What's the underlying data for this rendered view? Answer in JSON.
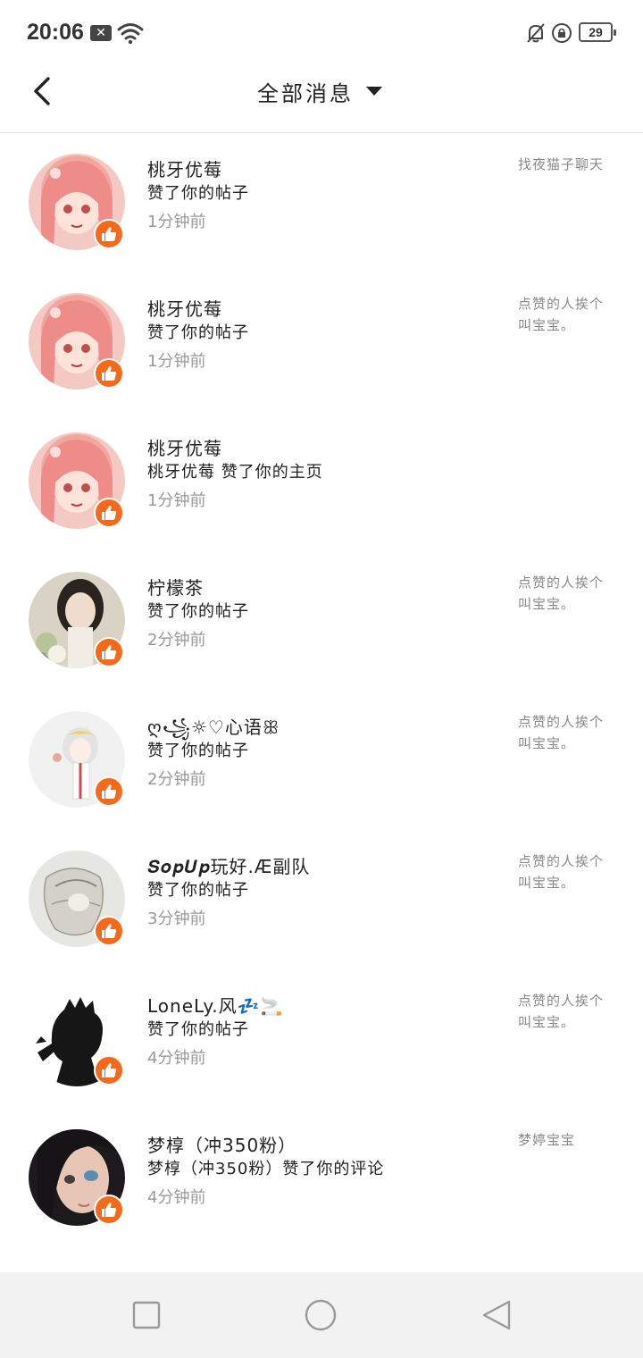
{
  "status_bar": {
    "time": "20:06",
    "notification_x": "✕",
    "battery": "29"
  },
  "header": {
    "title": "全部消息"
  },
  "messages": [
    {
      "name": "桃牙优莓",
      "action": "赞了你的帖子",
      "time": "1分钟前",
      "preview": "找夜猫子聊天",
      "avatar": "pink-anime-girl"
    },
    {
      "name": "桃牙优莓",
      "action": "赞了你的帖子",
      "time": "1分钟前",
      "preview": "点赞的人挨个叫宝宝。",
      "avatar": "pink-anime-girl"
    },
    {
      "name": "桃牙优莓",
      "action": "桃牙优莓 赞了你的主页",
      "time": "1分钟前",
      "preview": "",
      "avatar": "pink-anime-girl"
    },
    {
      "name": "柠檬茶",
      "action": "赞了你的帖子",
      "time": "2分钟前",
      "preview": "点赞的人挨个叫宝宝。",
      "avatar": "woman-with-flowers"
    },
    {
      "name": "ღ꧁☼♡心语ꕥ",
      "action": "赞了你的帖子",
      "time": "2分钟前",
      "preview": "点赞的人挨个叫宝宝。",
      "avatar": "white-hair-anime"
    },
    {
      "name": "𝑺𝒐𝒑𝑼𝒑玩好.Æ副队",
      "action": "赞了你的帖子",
      "time": "3分钟前",
      "preview": "点赞的人挨个叫宝宝。",
      "avatar": "sketch-anime"
    },
    {
      "name": "LoneLy.风💤🚬",
      "action": "赞了你的帖子",
      "time": "4分钟前",
      "preview": "点赞的人挨个叫宝宝。",
      "avatar": "black-silhouette"
    },
    {
      "name": "梦椁（冲350粉）",
      "action": "梦椁（冲350粉）赞了你的评论",
      "time": "4分钟前",
      "preview": "梦婷宝宝",
      "avatar": "dark-hair-anime"
    }
  ],
  "icons": {
    "back": "chevron-left-icon",
    "caret": "caret-down-icon",
    "like": "thumbs-up-icon",
    "nav_recent": "square-icon",
    "nav_home": "circle-icon",
    "nav_back": "triangle-back-icon"
  },
  "colors": {
    "accent": "#f46a1c",
    "divider": "#e2e2e2",
    "muted": "#999999",
    "nav_bg": "#f2f2f2"
  }
}
